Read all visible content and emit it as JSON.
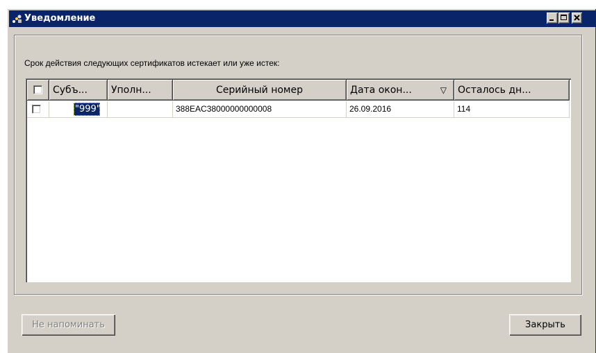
{
  "window": {
    "title": "Уведомление",
    "controls": [
      "minimize-icon",
      "maximize-icon",
      "close-icon"
    ]
  },
  "message": "Срок действия следующих сертификатов истекает или уже истек:",
  "table": {
    "columns": [
      "Субъ...",
      "Уполн...",
      "Серийный номер",
      "Дата окон...",
      "Осталось дн..."
    ],
    "sort_indicator": "▽",
    "rows": [
      {
        "checked": false,
        "subject": "\"999\"",
        "authorized": "",
        "serial": "388EAC38000000000008",
        "end_date": "26.09.2016",
        "days_left": "114"
      }
    ]
  },
  "buttons": {
    "dont_remind": "Не напоминать",
    "close": "Закрыть"
  },
  "colors": {
    "titlebar": "#0a246a",
    "face": "#d4d0c8",
    "selection": "#0a246a"
  }
}
